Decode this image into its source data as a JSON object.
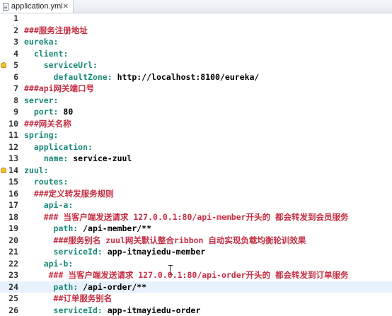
{
  "tab": {
    "title": "application.yml",
    "close_glyph": "✕"
  },
  "lines": [
    {
      "n": "1",
      "indent": "",
      "key": "",
      "comment": "",
      "val": ""
    },
    {
      "n": "2",
      "indent": "",
      "key": "",
      "comment": "###服务注册地址",
      "val": ""
    },
    {
      "n": "3",
      "indent": "",
      "key": "eureka:",
      "comment": "",
      "val": ""
    },
    {
      "n": "4",
      "indent": "  ",
      "key": "client:",
      "comment": "",
      "val": ""
    },
    {
      "n": "5",
      "indent": "    ",
      "key": "serviceUrl:",
      "comment": "",
      "val": "",
      "warn": true
    },
    {
      "n": "6",
      "indent": "      ",
      "key": "defaultZone:",
      "comment": "",
      "val": " http://localhost:8100/eureka/"
    },
    {
      "n": "7",
      "indent": "",
      "key": "",
      "comment": "###api网关端口号",
      "val": ""
    },
    {
      "n": "8",
      "indent": "",
      "key": "server:",
      "comment": "",
      "val": ""
    },
    {
      "n": "9",
      "indent": "  ",
      "key": "port:",
      "comment": "",
      "val": " 80"
    },
    {
      "n": "10",
      "indent": "",
      "key": "",
      "comment": "###网关名称",
      "val": ""
    },
    {
      "n": "11",
      "indent": "",
      "key": "spring:",
      "comment": "",
      "val": ""
    },
    {
      "n": "12",
      "indent": "  ",
      "key": "application:",
      "comment": "",
      "val": ""
    },
    {
      "n": "13",
      "indent": "    ",
      "key": "name:",
      "comment": "",
      "val": " service-zuul"
    },
    {
      "n": "14",
      "indent": "",
      "key": "zuul:",
      "comment": "",
      "val": "",
      "warn": true
    },
    {
      "n": "15",
      "indent": "  ",
      "key": "routes:",
      "comment": "",
      "val": ""
    },
    {
      "n": "16",
      "indent": "  ",
      "key": "",
      "comment": "###定义转发服务规则",
      "val": ""
    },
    {
      "n": "17",
      "indent": "    ",
      "key": "api-a:",
      "comment": "",
      "val": ""
    },
    {
      "n": "18",
      "indent": "    ",
      "key": "",
      "comment": "### 当客户端发送请求 127.0.0.1:80/api-member开头的 都会转发到会员服务",
      "val": ""
    },
    {
      "n": "19",
      "indent": "      ",
      "key": "path:",
      "comment": "",
      "val": " /api-member/**"
    },
    {
      "n": "20",
      "indent": "      ",
      "key": "",
      "comment": "###服务别名 zuul网关默认整合ribbon 自动实现负载均衡轮训效果",
      "val": ""
    },
    {
      "n": "21",
      "indent": "      ",
      "key": "serviceId:",
      "comment": "",
      "val": " app-itmayiedu-member"
    },
    {
      "n": "22",
      "indent": "    ",
      "key": "api-b:",
      "comment": "",
      "val": ""
    },
    {
      "n": "23",
      "indent": "     ",
      "key": "",
      "comment": "### 当客户端发送请求 127.0.0.1:80/api-order开头的 都会转发到订单服务",
      "val": ""
    },
    {
      "n": "24",
      "indent": "      ",
      "key": "path:",
      "comment": "",
      "val": " /api-order/**",
      "current": true
    },
    {
      "n": "25",
      "indent": "      ",
      "key": "",
      "comment": "##订单服务别名",
      "val": ""
    },
    {
      "n": "26",
      "indent": "      ",
      "key": "serviceId:",
      "comment": "",
      "val": " app-itmayiedu-order"
    }
  ],
  "colors": {
    "key": "#1a8a7a",
    "comment": "#c52f44",
    "value": "#000000",
    "current_line": "#e8f2fe"
  },
  "icons": {
    "tab": "yaml-file-icon",
    "warning": "warning-icon",
    "cursor": "text-cursor-icon"
  }
}
